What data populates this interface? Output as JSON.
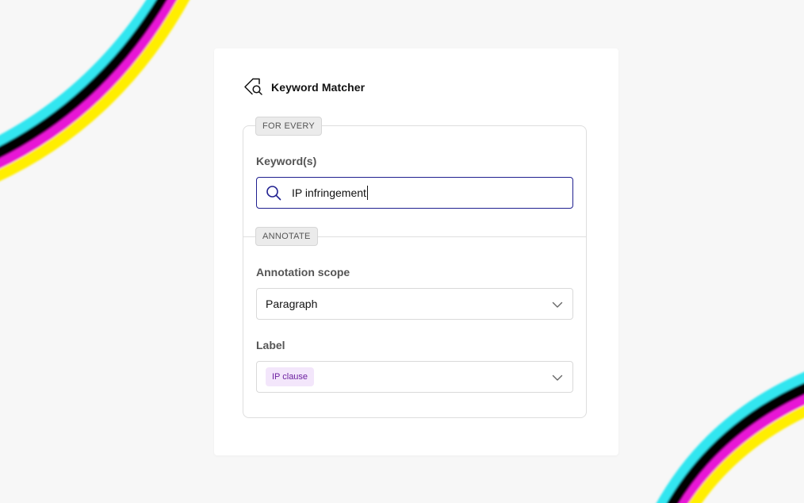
{
  "app": {
    "title": "Keyword Matcher"
  },
  "sections": {
    "for_every": {
      "tag": "FOR EVERY",
      "keywords_label": "Keyword(s)",
      "keywords_value": "IP infringement"
    },
    "annotate": {
      "tag": "ANNOTATE",
      "scope_label": "Annotation scope",
      "scope_value": "Paragraph",
      "label_label": "Label",
      "label_chip": "IP clause"
    }
  },
  "icons": {
    "app_icon": "tag-search-icon",
    "search": "search-icon",
    "dropdown": "chevron-down-icon"
  },
  "colors": {
    "page_background": "#f7f7f7",
    "card_background": "#ffffff",
    "input_focus_border": "#1f1f8f",
    "chip_background": "#f3e6fb",
    "chip_text": "#6c1fa0",
    "deco_stripes": [
      "#33e6f0",
      "#000000",
      "#e815d6",
      "#ffee00"
    ]
  }
}
